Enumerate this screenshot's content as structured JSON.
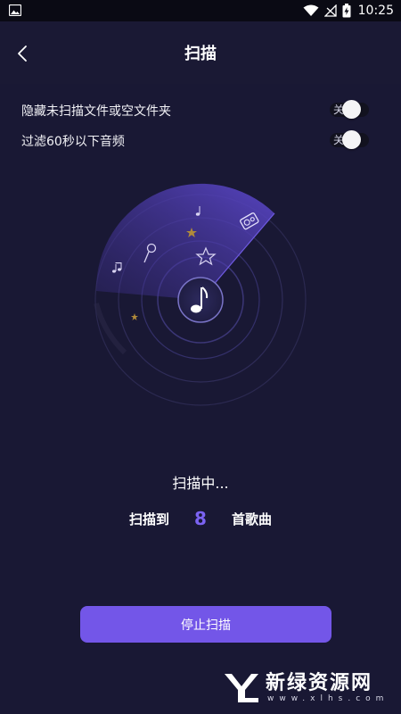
{
  "status_bar": {
    "time": "10:25"
  },
  "header": {
    "title": "扫描"
  },
  "settings": [
    {
      "label": "隐藏未扫描文件或空文件夹",
      "toggle_text": "关",
      "on": false
    },
    {
      "label": "过滤60秒以下音频",
      "toggle_text": "关",
      "on": false
    }
  ],
  "scan": {
    "status": "扫描中...",
    "count_prefix": "扫描到",
    "count": "8",
    "count_suffix": "首歌曲"
  },
  "actions": {
    "stop_label": "停止扫描"
  },
  "watermark": {
    "name": "新绿资源网",
    "url": "www.xlhs.com"
  },
  "colors": {
    "background": "#191834",
    "accent": "#7356e8",
    "count_color": "#7b63f2"
  }
}
